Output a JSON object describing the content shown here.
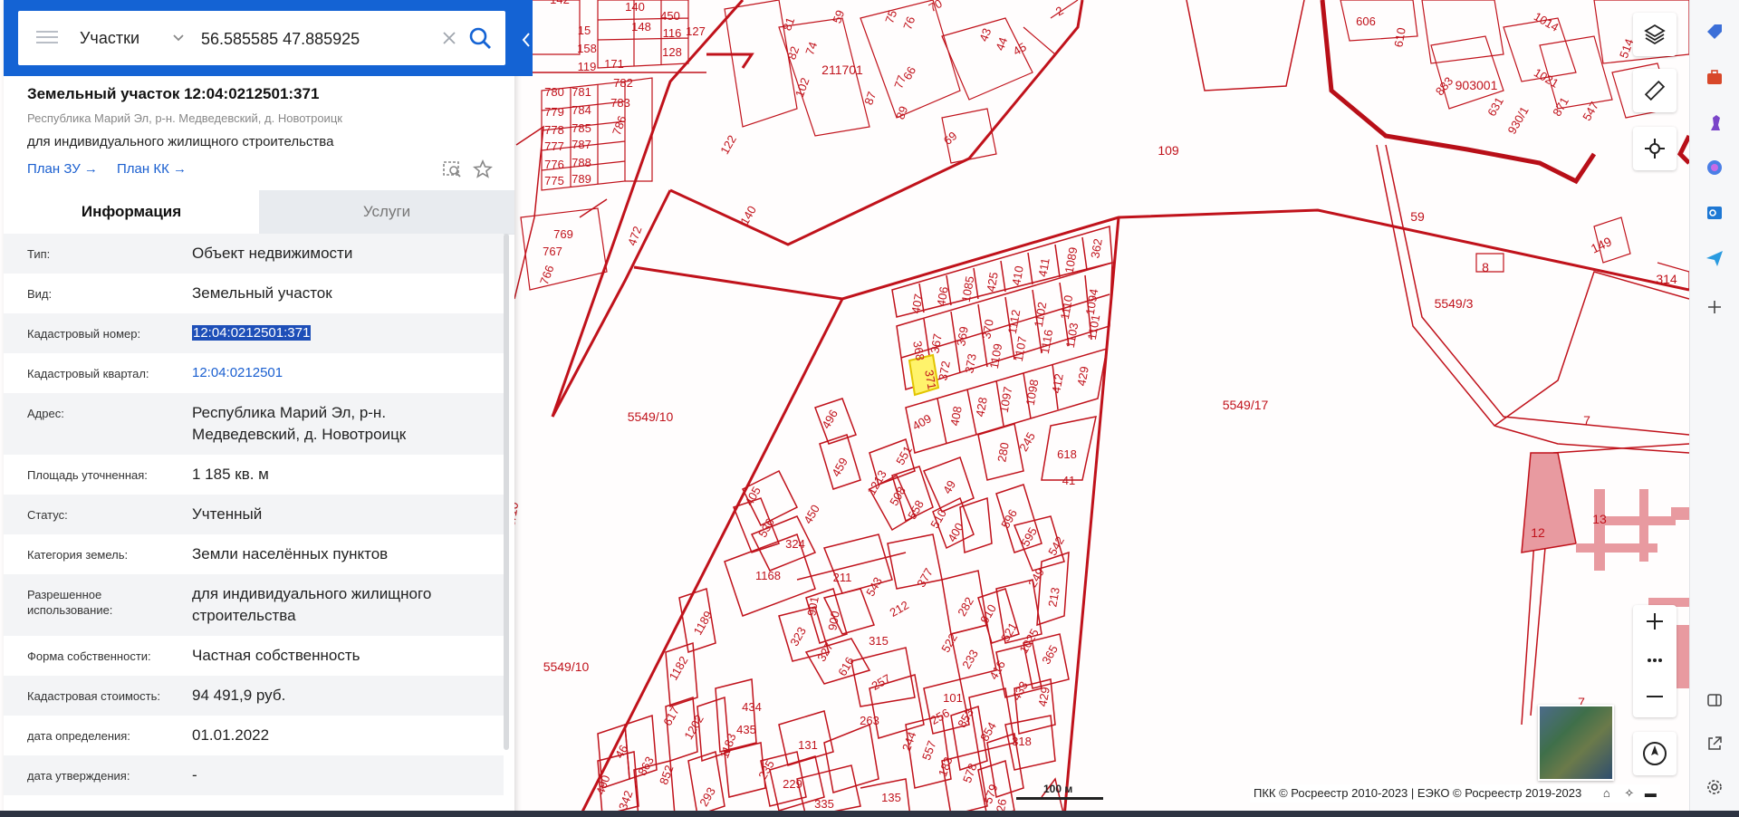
{
  "search": {
    "type_label": "Участки",
    "query": "56.585585 47.885925"
  },
  "object": {
    "title": "Земельный участок 12:04:0212501:371",
    "address_short": "Республика Марий Эл, р-н. Медведевский, д. Новотроицк",
    "use_short": "для индивидуального жилищного строительства",
    "plan_zu": "План ЗУ →",
    "plan_kk": "План КК →"
  },
  "tabs": {
    "info": "Информация",
    "services": "Услуги"
  },
  "info_rows": [
    {
      "label": "Тип:",
      "value": "Объект недвижимости"
    },
    {
      "label": "Вид:",
      "value": "Земельный участок"
    },
    {
      "label": "Кадастровый номер:",
      "value": "12:04:0212501:371"
    },
    {
      "label": "Кадастровый квартал:",
      "value": "12:04:0212501"
    },
    {
      "label": "Адрес:",
      "value": "Республика Марий Эл, р-н. Медведевский, д. Новотроицк"
    },
    {
      "label": "Площадь уточненная:",
      "value": "1 185 кв. м"
    },
    {
      "label": "Статус:",
      "value": "Учтенный"
    },
    {
      "label": "Категория земель:",
      "value": "Земли населённых пунктов"
    },
    {
      "label": "Разрешенное использование:",
      "value": "для индивидуального жилищного строительства"
    },
    {
      "label": "Форма собственности:",
      "value": "Частная собственность"
    },
    {
      "label": "Кадастровая стоимость:",
      "value": "94 491,9 руб."
    },
    {
      "label": "дата определения:",
      "value": "01.01.2022"
    },
    {
      "label": "дата утверждения:",
      "value": "-"
    }
  ],
  "map": {
    "labels": {
      "q211701": "211701",
      "q903001": "903001",
      "n109": "109",
      "n59": "59",
      "n5549_3": "5549/3",
      "n5549_17": "5549/17",
      "n5549_10a": "5549/10",
      "n5549_10b": "5549/10",
      "n5549_10c": "5549/10",
      "n7a": "7",
      "n7b": "7",
      "n8": "8",
      "n12": "12",
      "n13": "13",
      "n149": "149",
      "n314": "314",
      "n362": "362",
      "n1089": "1089",
      "n411": "411",
      "n410": "410",
      "n425": "425",
      "n1085": "1085",
      "n406": "406",
      "n407": "407",
      "n368": "368",
      "n367": "367",
      "n369": "369",
      "n370": "370",
      "n1112": "1112",
      "n1102": "1102",
      "n1110": "1110",
      "n1094": "1094",
      "n371": "371",
      "n372": "372",
      "n373": "373",
      "n1109": "1109",
      "n1107": "1107",
      "n1116": "1116",
      "n1103": "1103",
      "n1101": "1101",
      "n409": "409",
      "n408": "408",
      "n428": "428",
      "n1097": "1097",
      "n1098": "1098",
      "n412": "412",
      "n429a": "429",
      "n280": "280",
      "n245": "245",
      "n618": "618",
      "n41": "41",
      "n496": "496",
      "n459": "459",
      "n551": "551",
      "n1213": "1213",
      "n508": "508",
      "n558": "558",
      "n510": "510",
      "n49": "49",
      "n400": "400",
      "n596": "596",
      "n595": "595",
      "n542": "542",
      "n405": "405",
      "n450": "450",
      "n536": "536",
      "n324": "324",
      "n1168": "1168",
      "n211": "211",
      "n543": "543",
      "n377": "377",
      "n212": "212",
      "n249": "249",
      "n213": "213",
      "n282": "282",
      "n910": "910",
      "n521": "521",
      "n1025": "1025",
      "n365": "365",
      "n522": "522",
      "n233": "233",
      "n416": "416",
      "n433": "433",
      "n429b": "429",
      "n901": "901",
      "n900": "900",
      "n323": "323",
      "n327": "327",
      "n315": "315",
      "n616": "616",
      "n257": "257",
      "n1189": "1189",
      "n1182": "1182",
      "n617": "617",
      "n1202": "1202",
      "n434": "434",
      "n435": "435",
      "n1183": "1183",
      "n131": "131",
      "n263": "263",
      "n101": "101",
      "n256": "256",
      "n853": "853",
      "n854": "854",
      "n318": "318",
      "n244": "244",
      "n557": "557",
      "n183": "183",
      "n578": "578",
      "n579": "579",
      "n46": "46",
      "n863": "863",
      "n852": "852",
      "n490": "490",
      "n342": "342",
      "n293": "293",
      "n235": "235",
      "n229": "229",
      "n335": "335",
      "n135": "135",
      "n26": "26",
      "n140": "140",
      "n122": "122",
      "n69": "69",
      "n66": "66",
      "n87": "87",
      "n89": "89",
      "n77": "77",
      "n102": "102",
      "n74": "74",
      "n82": "82",
      "n81": "81",
      "n59b": "59",
      "n76": "76",
      "n75": "75",
      "n70": "70",
      "n43": "43",
      "n44": "44",
      "n45": "45",
      "n2": "2",
      "n606": "606",
      "n610": "610",
      "n1014": "1014",
      "n514": "514",
      "n883": "883",
      "n1021": "1021",
      "n631": "631",
      "n930_1": "930/1",
      "n871": "871",
      "n547": "547",
      "n780": "780",
      "n781": "781",
      "n782": "782",
      "n779": "779",
      "n784": "784",
      "n783": "783",
      "n778": "778",
      "n785": "785",
      "n777": "777",
      "n787": "787",
      "n776": "776",
      "n788": "788",
      "n775": "775",
      "n789": "789",
      "n786": "786",
      "n769": "769",
      "n767": "767",
      "n766": "766",
      "n140b": "140",
      "n450b": "450",
      "n148": "148",
      "n128": "128",
      "n116": "116",
      "n127": "127",
      "n119": "119",
      "n171": "171",
      "n158": "158",
      "n15": "15",
      "n142": "142",
      "n472": "472"
    },
    "scale": "100 м",
    "attribution": "ПКК © Росреестр 2010-2023 | ЕЭКО © Росреестр 2019-2023"
  },
  "colors": {
    "brand_blue": "#1463d4",
    "parcel_line": "#c0121b",
    "selected_parcel": "#fff36b",
    "link": "#1a5fd0"
  },
  "icons": [
    "menu-icon",
    "chevron-down-icon",
    "clear-icon",
    "search-icon",
    "chevron-left-icon",
    "zoom-to-object-icon",
    "star-icon",
    "layers-icon",
    "ruler-icon",
    "crosshair-icon",
    "zoom-in-icon",
    "more-icon",
    "zoom-out-icon",
    "compass-icon",
    "home-icon",
    "locate-icon",
    "panel-icon"
  ]
}
